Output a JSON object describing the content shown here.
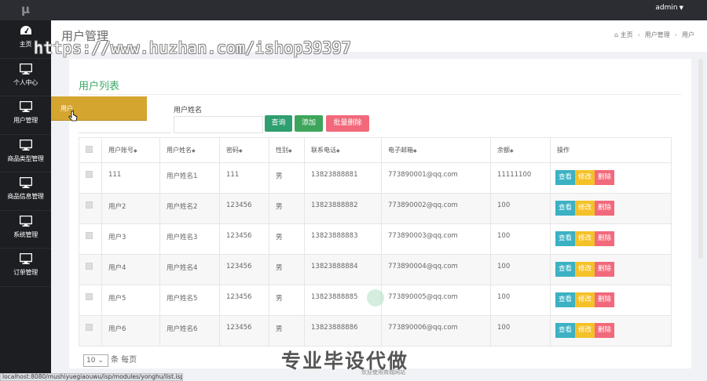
{
  "logo": "μ",
  "user": {
    "name": "admin"
  },
  "nav": [
    {
      "label": "主页",
      "icon": "dashboard-icon"
    },
    {
      "label": "个人中心",
      "icon": "monitor-icon"
    },
    {
      "label": "用户管理",
      "icon": "monitor-icon"
    },
    {
      "label": "商品类型管理",
      "icon": "monitor-icon"
    },
    {
      "label": "商品信息管理",
      "icon": "monitor-icon"
    },
    {
      "label": "系统管理",
      "icon": "monitor-icon"
    },
    {
      "label": "订单管理",
      "icon": "monitor-icon"
    }
  ],
  "page": {
    "title": "用户管理"
  },
  "breadcrumb": {
    "home": "主页",
    "mid": "用户管理",
    "current": "用户"
  },
  "watermark": "https://www.huzhan.com/ishop39397",
  "card": {
    "title": "用户列表"
  },
  "dropdown": {
    "item": "用户"
  },
  "search": {
    "label": "用户姓名",
    "value": ""
  },
  "buttons": {
    "query": "查询",
    "add": "添加",
    "batch_delete": "批量删除"
  },
  "table": {
    "headers": [
      "用户账号",
      "用户姓名",
      "密码",
      "性别",
      "联系电话",
      "电子邮箱",
      "余额",
      "操作"
    ],
    "rows": [
      [
        "111",
        "用户姓名1",
        "111",
        "男",
        "13823888881",
        "773890001@qq.com",
        "11111100"
      ],
      [
        "用户2",
        "用户姓名2",
        "123456",
        "男",
        "13823888882",
        "773890002@qq.com",
        "100"
      ],
      [
        "用户3",
        "用户姓名3",
        "123456",
        "男",
        "13823888883",
        "773890003@qq.com",
        "100"
      ],
      [
        "用户4",
        "用户姓名4",
        "123456",
        "男",
        "13823888884",
        "773890004@qq.com",
        "100"
      ],
      [
        "用户5",
        "用户姓名5",
        "123456",
        "男",
        "13823888885",
        "773890005@qq.com",
        "100"
      ],
      [
        "用户6",
        "用户姓名6",
        "123456",
        "男",
        "13823888886",
        "773890006@qq.com",
        "100"
      ]
    ],
    "actions": {
      "view": "查看",
      "edit": "修改",
      "delete": "删除"
    }
  },
  "pager": {
    "page_size": "10",
    "suffix": "条 每页"
  },
  "promo": {
    "text": "专业毕设代做",
    "sub": "欢迎使用商城网站"
  },
  "status_url": "localhost:8080/mushiyuegiaouwu/isp/modules/yonghu/list.isp"
}
